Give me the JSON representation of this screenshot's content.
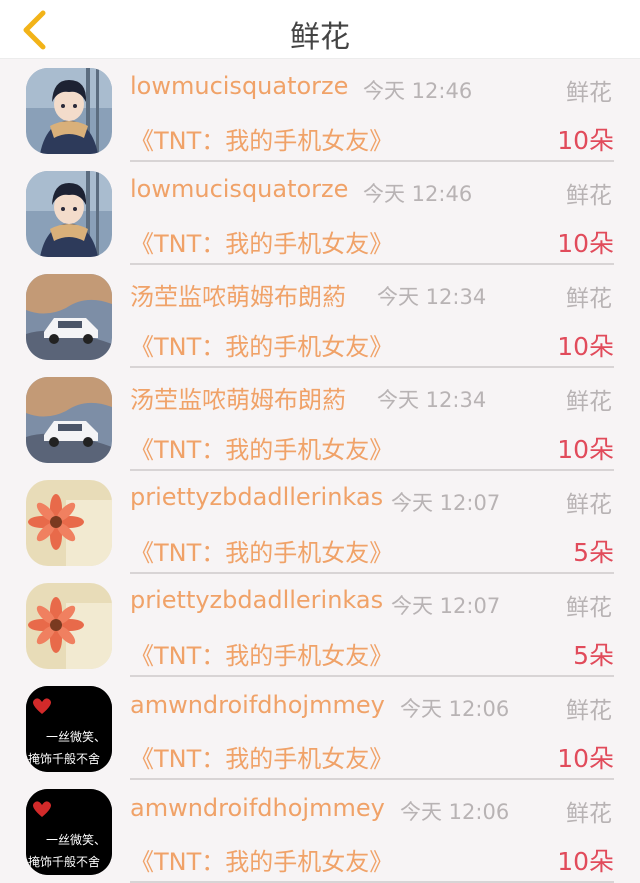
{
  "header": {
    "title": "鲜花",
    "back_icon": "chevron-left-icon",
    "back_color": "#f2b318"
  },
  "colors": {
    "name": "#f0a268",
    "time": "#b8b3b4",
    "count": "#e14b5b"
  },
  "items": [
    {
      "name": "lowmucisquatorze",
      "time": "今天 12:46",
      "gift": "鲜花",
      "product": "《TNT：我的手机女友》",
      "count": "10朵",
      "avatar": "anime-boy-avatar"
    },
    {
      "name": "lowmucisquatorze",
      "time": "今天 12:46",
      "gift": "鲜花",
      "product": "《TNT：我的手机女友》",
      "count": "10朵",
      "avatar": "anime-boy-avatar"
    },
    {
      "name": "汤茔监哝萌姆布朗葯",
      "time": "今天 12:34",
      "gift": "鲜花",
      "product": "《TNT：我的手机女友》",
      "count": "10朵",
      "avatar": "car-avatar"
    },
    {
      "name": "汤茔监哝萌姆布朗葯",
      "time": "今天 12:34",
      "gift": "鲜花",
      "product": "《TNT：我的手机女友》",
      "count": "10朵",
      "avatar": "car-avatar"
    },
    {
      "name": "priettyzbdadllerinkas",
      "time": "今天 12:07",
      "gift": "鲜花",
      "product": "《TNT：我的手机女友》",
      "count": "5朵",
      "avatar": "flower-avatar"
    },
    {
      "name": "priettyzbdadllerinkas",
      "time": "今天 12:07",
      "gift": "鲜花",
      "product": "《TNT：我的手机女友》",
      "count": "5朵",
      "avatar": "flower-avatar"
    },
    {
      "name": "amwndroifdhojmmey",
      "time": "今天 12:06",
      "gift": "鲜花",
      "product": "《TNT：我的手机女友》",
      "count": "10朵",
      "avatar": "text-avatar",
      "avatar_text": [
        "一丝微笑、",
        "掩饰千般不舍"
      ]
    },
    {
      "name": "amwndroifdhojmmey",
      "time": "今天 12:06",
      "gift": "鲜花",
      "product": "《TNT：我的手机女友》",
      "count": "10朵",
      "avatar": "text-avatar",
      "avatar_text": [
        "一丝微笑、",
        "掩饰千般不舍"
      ]
    }
  ]
}
